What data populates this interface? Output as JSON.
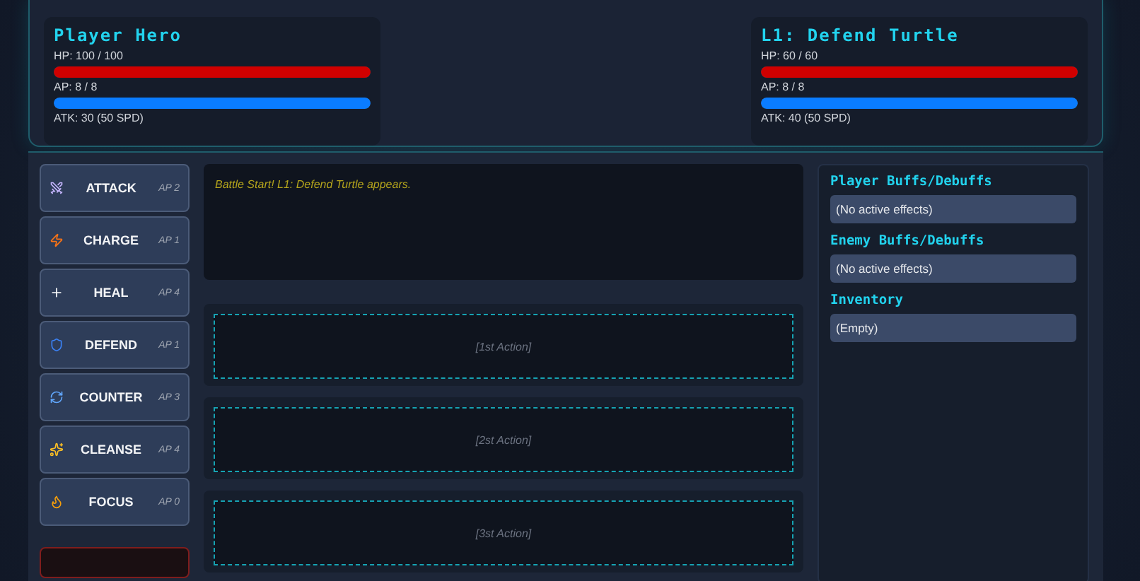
{
  "combatants": [
    {
      "name": "Player Hero",
      "hp": {
        "text": "HP: 100 / 100",
        "level": 1
      },
      "ap": {
        "text": "AP: 8 / 8",
        "level": 1
      },
      "stats": "ATK: 30 (50 SPD)"
    },
    {
      "name": "L1: Defend Turtle",
      "hp": {
        "text": "HP: 60 / 60",
        "level": 1
      },
      "ap": {
        "text": "AP: 8 / 8",
        "level": 1
      },
      "stats": "ATK: 40 (50 SPD)"
    }
  ],
  "actions": [
    {
      "kind": "attack",
      "label": "ATTACK",
      "cost": "AP 2"
    },
    {
      "kind": "charge",
      "label": "CHARGE",
      "cost": "AP 1"
    },
    {
      "kind": "heal",
      "label": "HEAL",
      "cost": "AP 4"
    },
    {
      "kind": "defend",
      "label": "DEFEND",
      "cost": "AP 1"
    },
    {
      "kind": "counter",
      "label": "COUNTER",
      "cost": "AP 3"
    },
    {
      "kind": "cleanse",
      "label": "CLEANSE",
      "cost": "AP 4"
    },
    {
      "kind": "focus",
      "label": "FOCUS",
      "cost": "AP 0"
    }
  ],
  "battle_log": [
    "Battle Start! L1: Defend Turtle appears."
  ],
  "action_slots": [
    "[1st Action]",
    "[2st Action]",
    "[3st Action]"
  ],
  "sidebar": [
    {
      "title": "Player Buffs/Debuffs",
      "value": "(No active effects)"
    },
    {
      "title": "Enemy Buffs/Debuffs",
      "value": "(No active effects)"
    },
    {
      "title": "Inventory",
      "value": "(Empty)"
    }
  ]
}
